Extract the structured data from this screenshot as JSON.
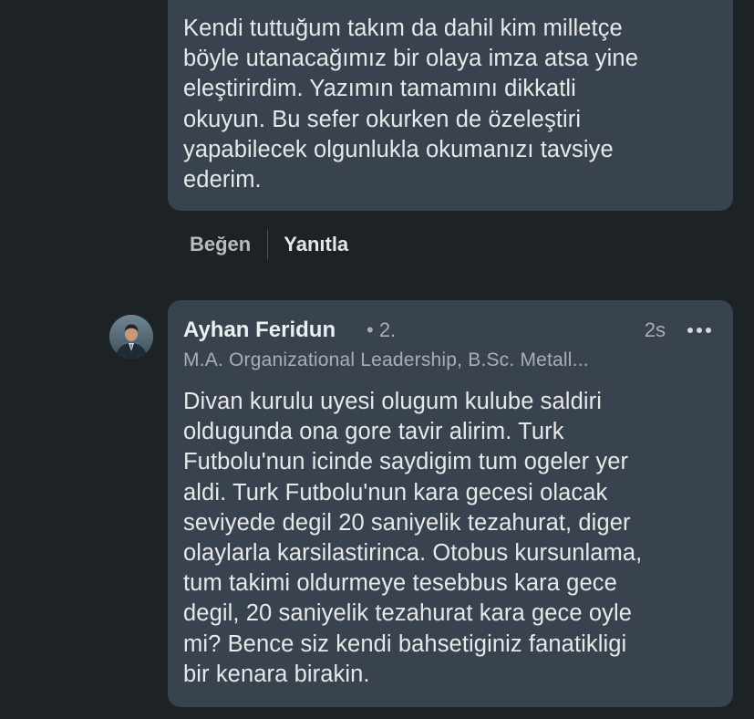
{
  "comments": [
    {
      "text": "Kendi tuttuğum takım da dahil kim milletçe\nböyle utanacağımız bir olaya imza atsa yine\neleştirirdim. Yazımın tamamını dikkatli\nokuyun. Bu sefer okurken de özeleştiri\nyapabilecek olgunlukla okumanızı tavsiye\nederim.",
      "actions": {
        "like_label": "Beğen",
        "reply_label": "Yanıtla"
      }
    },
    {
      "author": "Ayhan Feridun",
      "degree": "• 2.",
      "time": "2s",
      "headline": "M.A. Organizational Leadership, B.Sc. Metall...",
      "more_icon": "more-horizontal-icon",
      "text": "Divan kurulu uyesi olugum kulube saldiri\noldugunda ona gore tavir alirim. Turk\nFutbolu'nun icinde saydigim tum ogeler yer\naldi. Turk Futbolu'nun kara gecesi olacak\nseviyede degil 20 saniyelik tezahurat, diger\nolaylarla karsilastirinca. Otobus kursunlama,\ntum takimi oldurmeye tesebbus kara gece\ndegil, 20 saniyelik tezahurat kara gece oyle\nmi? Bence siz kendi bahsetiginiz fanatikligi\nbir kenara birakin."
    }
  ],
  "colors": {
    "background": "#1d2226",
    "bubble": "#38434f",
    "text": "#e8e8e8",
    "muted": "#a9aeb3"
  }
}
